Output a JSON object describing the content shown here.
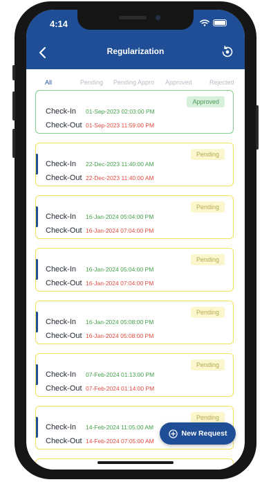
{
  "status_bar": {
    "time": "4:14"
  },
  "header": {
    "title": "Regularization"
  },
  "tabs": [
    {
      "label": "All",
      "active": true
    },
    {
      "label": "Pending",
      "active": false
    },
    {
      "label": "Pending Appro",
      "active": false
    },
    {
      "label": "Approved",
      "active": false
    },
    {
      "label": "Rejected",
      "active": false
    }
  ],
  "labels": {
    "check_in": "Check-In",
    "check_out": "Check-Out"
  },
  "requests": [
    {
      "status": "Approved",
      "check_in": "01-Sep-2023 02:03:00 PM",
      "check_out": "01-Sep-2023 11:59:00 PM"
    },
    {
      "status": "Pending",
      "check_in": "22-Dec-2023 11:40:00 AM",
      "check_out": "22-Dec-2023 11:40:00 AM"
    },
    {
      "status": "Pending",
      "check_in": "16-Jan-2024 05:04:00 PM",
      "check_out": "16-Jan-2024 07:04:00 PM"
    },
    {
      "status": "Pending",
      "check_in": "16-Jan-2024 05:04:00 PM",
      "check_out": "16-Jan-2024 07:04:00 PM"
    },
    {
      "status": "Pending",
      "check_in": "16-Jan-2024 05:08:00 PM",
      "check_out": "16-Jan-2024 05:08:00 PM"
    },
    {
      "status": "Pending",
      "check_in": "07-Feb-2024 01:13:00 PM",
      "check_out": "07-Feb-2024 01:14:00 PM"
    },
    {
      "status": "Pending",
      "check_in": "14-Feb-2024 11:05:00 AM",
      "check_out": "14-Feb-2024 07:05:00 AM"
    }
  ],
  "fab": {
    "label": "New Request"
  },
  "colors": {
    "primary": "#1f4e96",
    "approved": "#7fcf8a",
    "pending": "#f1e25a",
    "check_in": "#43a049",
    "check_out": "#e04b3f"
  },
  "icons": {
    "back": "chevron-left-icon",
    "history": "history-icon",
    "fab": "plus-circle-icon"
  }
}
